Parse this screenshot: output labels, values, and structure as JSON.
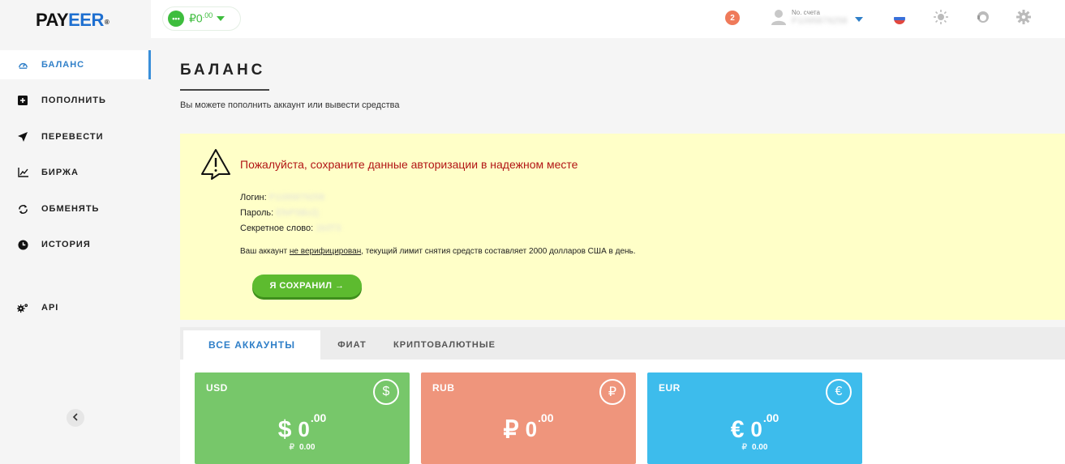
{
  "brand": {
    "logo_main": "PAY",
    "logo_accent": "EER",
    "logo_mark": "®"
  },
  "sidebar": {
    "items": [
      {
        "label": "БАЛАНС",
        "icon": "gauge-icon",
        "active": true
      },
      {
        "label": "ПОПОЛНИТЬ",
        "icon": "plus-square-icon"
      },
      {
        "label": "ПЕРЕВЕСТИ",
        "icon": "send-arrow-icon"
      },
      {
        "label": "БИРЖА",
        "icon": "chart-icon"
      },
      {
        "label": "ОБМЕНЯТЬ",
        "icon": "exchange-icon"
      },
      {
        "label": "ИСТОРИЯ",
        "icon": "clock-icon"
      },
      {
        "label": "API",
        "icon": "gears-icon"
      }
    ],
    "collapse_icon": "chevron-left-icon"
  },
  "topbar": {
    "wallet_symbol": "₽",
    "wallet_int": "0",
    "wallet_dec": ".00",
    "notifications": "2",
    "account_label": "No. счета",
    "account_number": "P1095879258",
    "accent": "#3ebd3e"
  },
  "main": {
    "title": "БАЛАНС",
    "subtitle": "Вы можете пополнить аккаунт или вывести средства"
  },
  "alert": {
    "title": "Пожалуйста, сохраните данные авторизации в надежном месте",
    "login_label": "Логин:",
    "login_value": "P1095879258",
    "password_label": "Пароль:",
    "password_value": "EfsPSBzZj",
    "secret_label": "Секретное слово:",
    "secret_value": "1b3T3",
    "note_before": "Ваш аккаунт ",
    "note_link": "не верифицирован",
    "note_after": ", текущий лимит снятия средств составляет 2000 долларов США в день.",
    "button": "Я СОХРАНИЛ →"
  },
  "tabs": [
    {
      "label": "ВСЕ АККАУНТЫ",
      "active": true
    },
    {
      "label": "ФИАТ"
    },
    {
      "label": "КРИПТОВАЛЮТНЫЕ"
    }
  ],
  "cards": [
    {
      "currency": "USD",
      "symbol": "$",
      "int": "0",
      "dec": ".00",
      "rub_symbol": "₽",
      "rub_value": "0.00",
      "color": "#77c76a"
    },
    {
      "currency": "RUB",
      "symbol": "₽",
      "int": "0",
      "dec": ".00",
      "rub_symbol": "",
      "rub_value": "",
      "color": "#ef957c"
    },
    {
      "currency": "EUR",
      "symbol": "€",
      "int": "0",
      "dec": ".00",
      "rub_symbol": "₽",
      "rub_value": "0.00",
      "color": "#3dbcec"
    }
  ]
}
